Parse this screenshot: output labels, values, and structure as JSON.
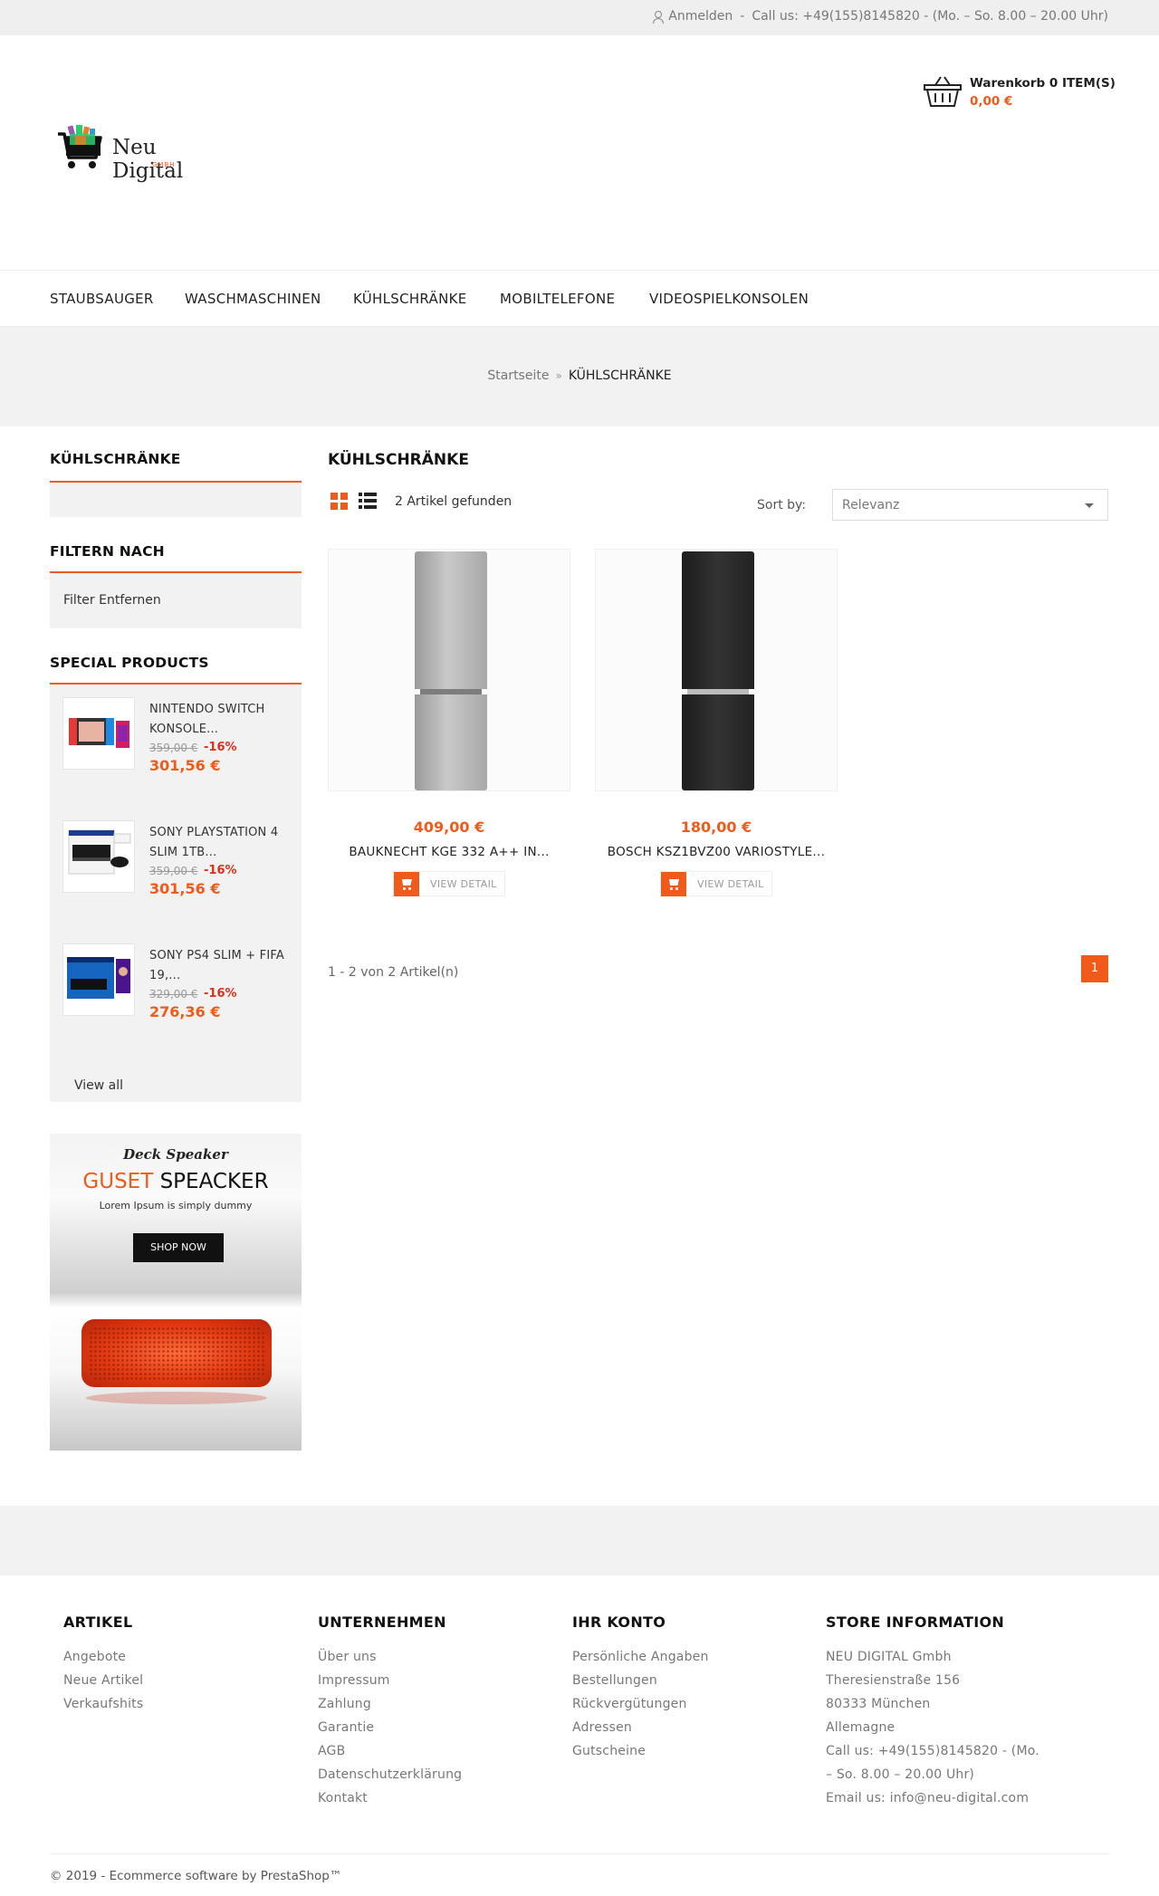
{
  "topbar": {
    "login": "Anmelden",
    "separator": "-",
    "contact": "Call us: +49(155)8145820 - (Mo. – So. 8.00 – 20.00 Uhr)"
  },
  "header": {
    "logo_text": "Neu Digital",
    "logo_sub": "GMBH",
    "cart_label": "Warenkorb 0 ITEM(S)",
    "cart_total": "0,00 €"
  },
  "nav": {
    "items": [
      {
        "label": "STAUBSAUGER"
      },
      {
        "label": "WASCHMASCHINEN"
      },
      {
        "label": "KÜHLSCHRÄNKE"
      },
      {
        "label": "MOBILTELEFONE"
      },
      {
        "label": "VIDEOSPIELKONSOLEN"
      }
    ]
  },
  "breadcrumb": {
    "home": "Startseite",
    "sep": "»",
    "current": "KÜHLSCHRÄNKE"
  },
  "sidebar": {
    "category_title": "KÜHLSCHRÄNKE",
    "filter_title": "FILTERN NACH",
    "filter_clear": "Filter Entfernen",
    "special_title": "SPECIAL PRODUCTS",
    "special_items": [
      {
        "name": "NINTENDO SWITCH KONSOLE...",
        "old_price": "359,00 €",
        "discount": "-16%",
        "price": "301,56 €"
      },
      {
        "name": "SONY PLAYSTATION 4 SLIM 1TB...",
        "old_price": "359,00 €",
        "discount": "-16%",
        "price": "301,56 €"
      },
      {
        "name": "SONY PS4 SLIM + FIFA 19,...",
        "old_price": "329,00 €",
        "discount": "-16%",
        "price": "276,36 €"
      }
    ],
    "view_all": "View all",
    "banner": {
      "script": "Deck Speaker",
      "title_highlight": "GUSET",
      "title_rest": "SPEACKER",
      "subtitle": "Lorem Ipsum is simply dummy",
      "button": "SHOP NOW"
    }
  },
  "main": {
    "title": "KÜHLSCHRÄNKE",
    "count": "2 Artikel gefunden",
    "sort_label": "Sort by:",
    "sort_value": "Relevanz",
    "products": [
      {
        "price": "409,00 €",
        "name": "BAUKNECHT KGE 332 A++ IN...",
        "button": "VIEW DETAIL",
        "color": "#b3b3b3"
      },
      {
        "price": "180,00 €",
        "name": "BOSCH KSZ1BVZ00 VARIOSTYLE...",
        "button": "VIEW DETAIL",
        "color": "#2a2a2a"
      }
    ],
    "pagination_text": "1 - 2 von 2 Artikel(n)",
    "page_number": "1"
  },
  "footer": {
    "col1": {
      "title": "ARTIKEL",
      "links": [
        "Angebote",
        "Neue Artikel",
        "Verkaufshits"
      ]
    },
    "col2": {
      "title": "UNTERNEHMEN",
      "links": [
        "Über uns",
        "Impressum",
        "Zahlung",
        "Garantie",
        "AGB",
        "Datenschutzerklärung",
        "Kontakt"
      ]
    },
    "col3": {
      "title": "IHR KONTO",
      "links": [
        "Persönliche Angaben",
        "Bestellungen",
        "Rückvergütungen",
        "Adressen",
        "Gutscheine"
      ]
    },
    "col4": {
      "title": "STORE INFORMATION",
      "lines": [
        "NEU DIGITAL Gmbh",
        "Theresienstraße 156",
        "80333 München",
        "Allemagne",
        "Call us: +49(155)8145820 - (Mo. – So. 8.00 – 20.00 Uhr)",
        "Email us: info@neu-digital.com"
      ]
    },
    "copyright": "© 2019 - Ecommerce software by PrestaShop™"
  },
  "colors": {
    "accent": "#f05a1a",
    "discount": "#d9301b"
  }
}
